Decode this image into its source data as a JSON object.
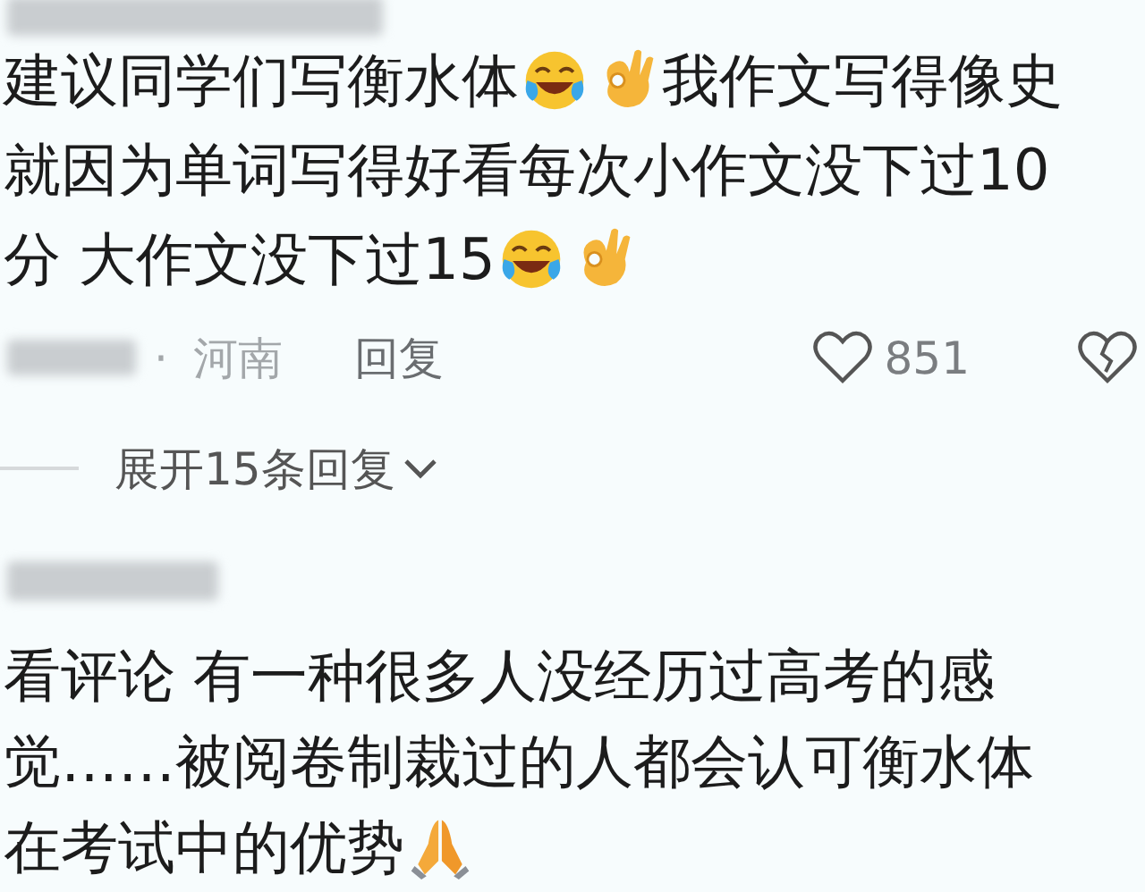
{
  "comments": [
    {
      "lines": [
        [
          {
            "kind": "text",
            "text": "建议同学们写衡水体"
          },
          {
            "kind": "laughing"
          },
          {
            "kind": "ok"
          },
          {
            "kind": "text",
            "text": "我作文写得像史"
          }
        ],
        [
          {
            "kind": "text",
            "text": "就因为单词写得好看每次小作文没下过10"
          }
        ],
        [
          {
            "kind": "text",
            "text": "分 大作文没下过15"
          },
          {
            "kind": "laughing"
          },
          {
            "kind": "ok"
          }
        ]
      ],
      "meta": {
        "separator": "·",
        "location": "河南",
        "reply": "回复",
        "likes": "851"
      },
      "expand": "展开15条回复"
    },
    {
      "lines": [
        [
          {
            "kind": "text",
            "text": "看评论 有一种很多人没经历过高考的感"
          }
        ],
        [
          {
            "kind": "text",
            "text": "觉……被阅卷制裁过的人都会认可衡水体"
          }
        ],
        [
          {
            "kind": "text",
            "text": "在考试中的优势"
          },
          {
            "kind": "praying"
          }
        ]
      ]
    }
  ]
}
